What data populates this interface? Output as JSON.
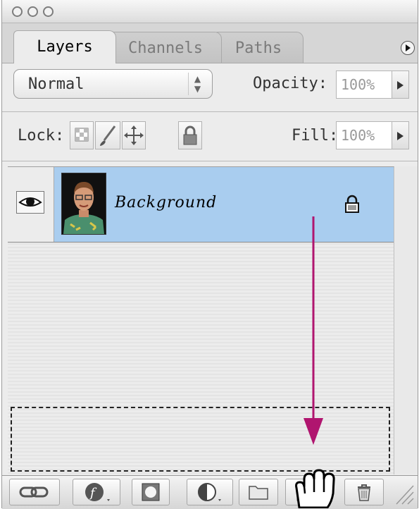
{
  "tabs": [
    {
      "label": "Layers"
    },
    {
      "label": "Channels"
    },
    {
      "label": "Paths"
    }
  ],
  "blend_mode": {
    "value": "Normal"
  },
  "opacity": {
    "label": "Opacity:",
    "value": "100%"
  },
  "lock": {
    "label": "Lock:"
  },
  "fill": {
    "label": "Fill:",
    "value": "100%"
  },
  "layers": [
    {
      "name": "Background",
      "visible": true,
      "locked": true,
      "selected": true
    }
  ],
  "colors": {
    "selection": "#a9cdef",
    "drag_arrow": "#b0156f"
  },
  "icons": {
    "title_bar": [
      "close-icon",
      "minimize-icon",
      "zoom-icon"
    ],
    "bottom_toolbar": [
      "link-icon",
      "layer-style-icon",
      "layer-mask-icon",
      "adjustment-layer-icon",
      "new-group-icon",
      "new-layer-icon",
      "trash-icon"
    ]
  }
}
